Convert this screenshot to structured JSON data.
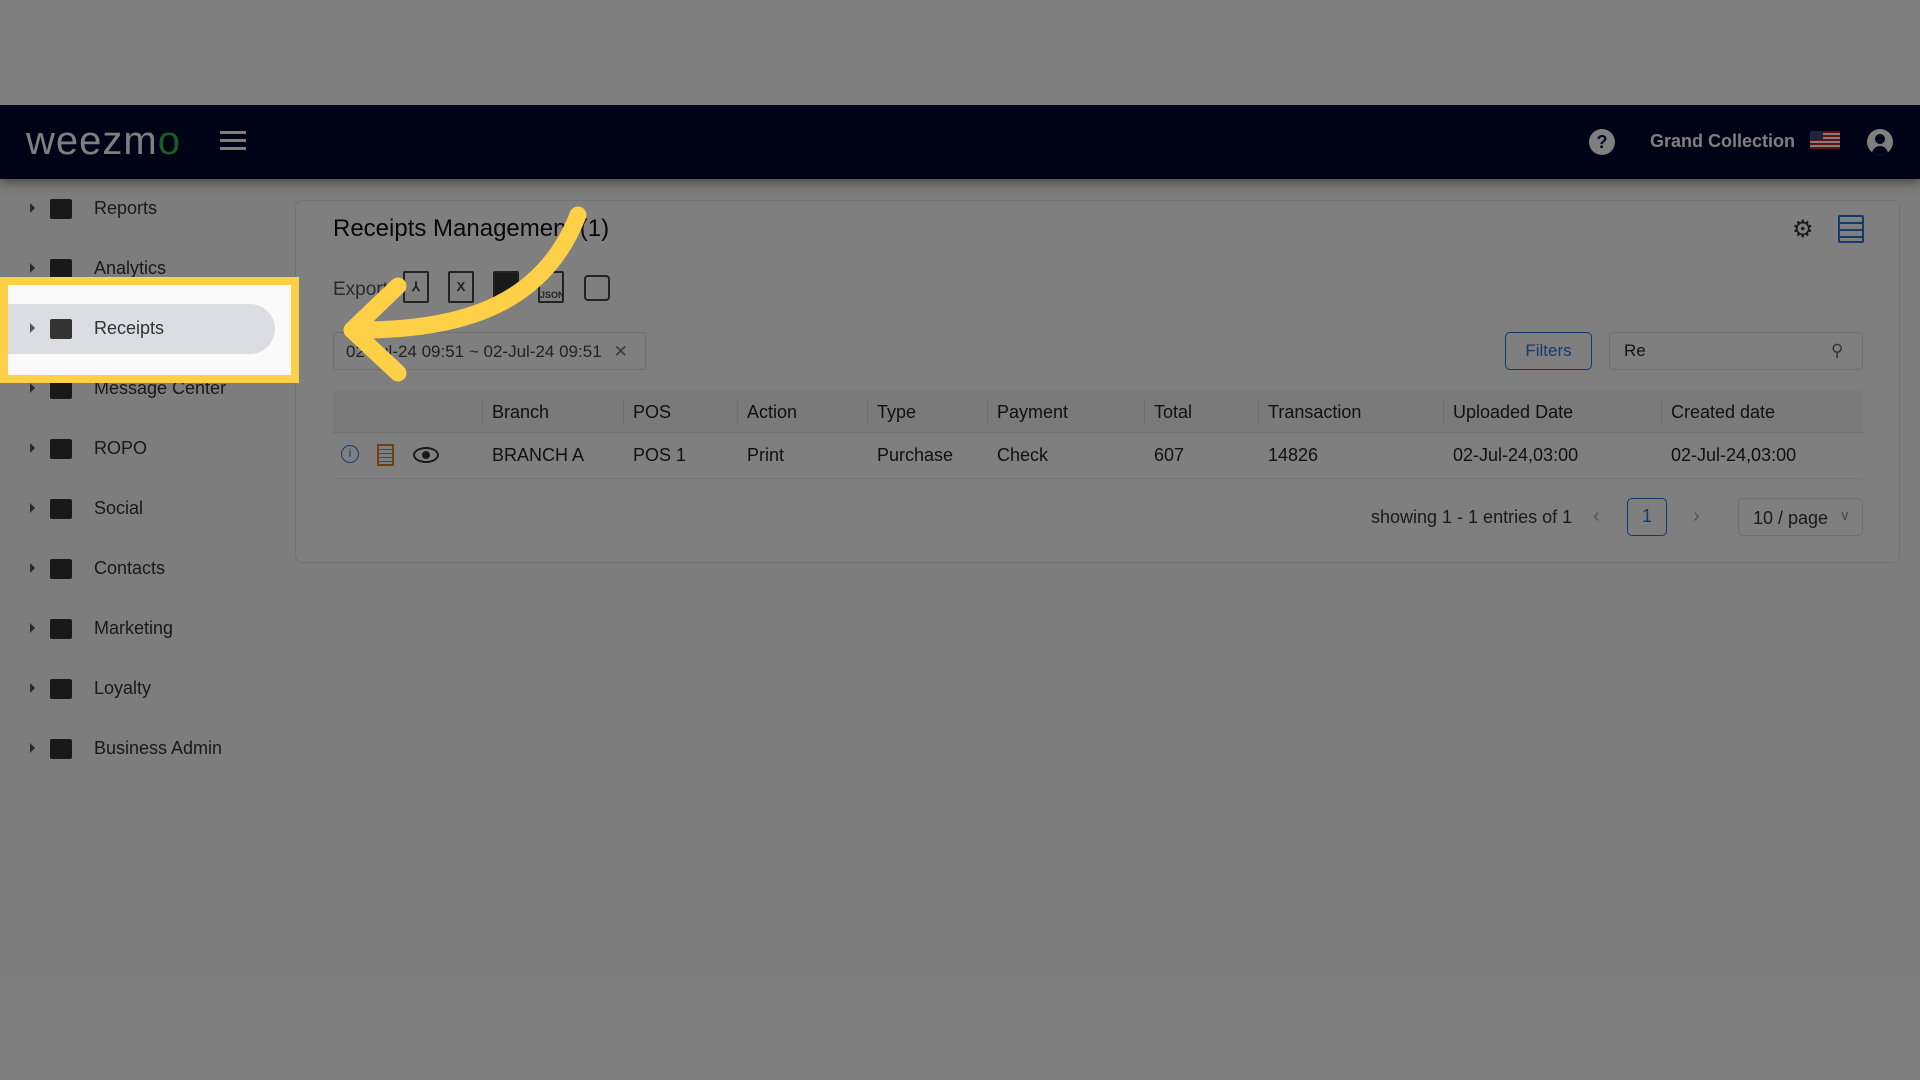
{
  "header": {
    "logo": "weezmo",
    "brand": "Grand Collection",
    "icons": [
      "menu-icon",
      "help-icon",
      "us-flag-icon",
      "user-icon"
    ]
  },
  "sidebar": {
    "items": [
      {
        "label": "Reports",
        "icon": "dashboard-icon"
      },
      {
        "label": "Analytics",
        "icon": "bar-chart-icon"
      },
      {
        "label": "Receipts",
        "icon": "receipt-icon",
        "active": true
      },
      {
        "label": "Message Center",
        "icon": "chat-icon"
      },
      {
        "label": "ROPO",
        "icon": "infinity-icon"
      },
      {
        "label": "Social",
        "icon": "people-icon"
      },
      {
        "label": "Contacts",
        "icon": "contacts-icon"
      },
      {
        "label": "Marketing",
        "icon": "megaphone-icon"
      },
      {
        "label": "Loyalty",
        "icon": "tag-icon"
      },
      {
        "label": "Business Admin",
        "icon": "gear-icon"
      }
    ]
  },
  "main": {
    "title": "Receipts Management (1)",
    "export_label": "Export",
    "export_icons": [
      "pdf-icon",
      "excel-icon",
      "csv-icon",
      "json-icon",
      "print-icon"
    ],
    "date_filter": "02-Jul-24 09:51 ~ 02-Jul-24 09:51",
    "filters_label": "Filters",
    "search_value": "Re",
    "table": {
      "columns": [
        "Branch",
        "POS",
        "Action",
        "Type",
        "Payment",
        "Total",
        "Transaction",
        "Uploaded Date",
        "Created date"
      ],
      "rows": [
        [
          "BRANCH A",
          "POS 1",
          "Print",
          "Purchase",
          "Check",
          "607",
          "14826",
          "02-Jul-24,03:00",
          "02-Jul-24,03:00"
        ]
      ]
    },
    "pagination": {
      "info": "showing 1 - 1 entries of 1",
      "page": "1",
      "per_page": "10 / page"
    }
  },
  "colors": {
    "nav": "#01042b",
    "accent": "#2a74d6",
    "highlight": "#fdd048"
  }
}
